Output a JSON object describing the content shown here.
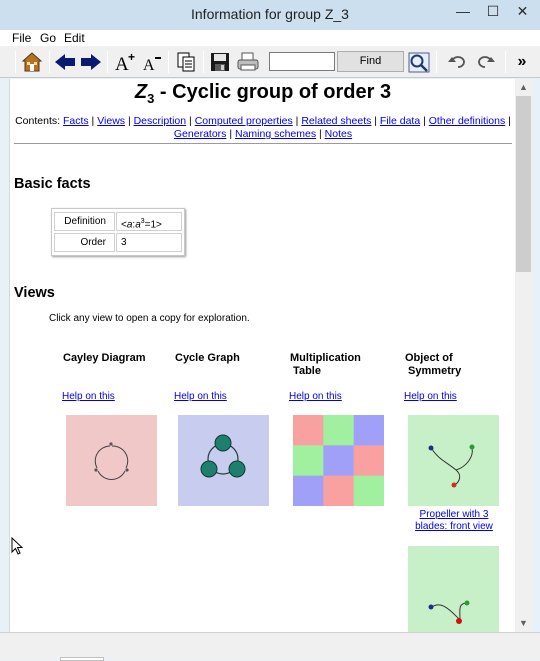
{
  "window": {
    "title": "Information for group Z_3",
    "minimize": "—",
    "maximize": "☐",
    "close": "✕"
  },
  "menu": [
    "File",
    "Go",
    "Edit"
  ],
  "toolbar": {
    "find_label": "Find",
    "overflow": "»"
  },
  "page": {
    "title_symbol": "Z",
    "title_sub": "3",
    "title_rest": " - Cyclic group of order 3",
    "contents_label": "Contents:",
    "contents_links": [
      "Facts",
      "Views",
      "Description",
      "Computed properties",
      "Related sheets",
      "File data",
      "Other definitions",
      "Generators",
      "Naming schemes",
      "Notes"
    ]
  },
  "basic_facts": {
    "heading": "Basic facts",
    "rows": [
      {
        "key": "Definition",
        "value_prefix": "<",
        "value_var": "a",
        "value_mid": ":",
        "value_var2": "a",
        "value_sup": "3",
        "value_suffix": "=1>"
      },
      {
        "key": "Order",
        "value": "3"
      }
    ]
  },
  "views": {
    "heading": "Views",
    "note": "Click any view to open a copy for exploration.",
    "help_label": "Help on this",
    "items": [
      {
        "title": "Cayley Diagram",
        "bg": "#f0c8c8"
      },
      {
        "title": "Cycle Graph",
        "bg": "#c8cdf0"
      },
      {
        "title": "Multiplication\n Table",
        "bg": "#ffffff"
      },
      {
        "title": "Object of\n Symmetry",
        "bg": "#c8f0c8"
      }
    ],
    "symmetry_caption": "Propeller with 3 blades: front view"
  },
  "colors": {
    "link": "#0000ee",
    "table_red": "#f9a0a0",
    "table_green": "#a0f0a0",
    "table_blue": "#a0a0f9",
    "node_teal": "#1f7f6f"
  },
  "multiplication_table": [
    [
      "red",
      "green",
      "blue"
    ],
    [
      "green",
      "blue",
      "red"
    ],
    [
      "blue",
      "red",
      "green"
    ]
  ]
}
